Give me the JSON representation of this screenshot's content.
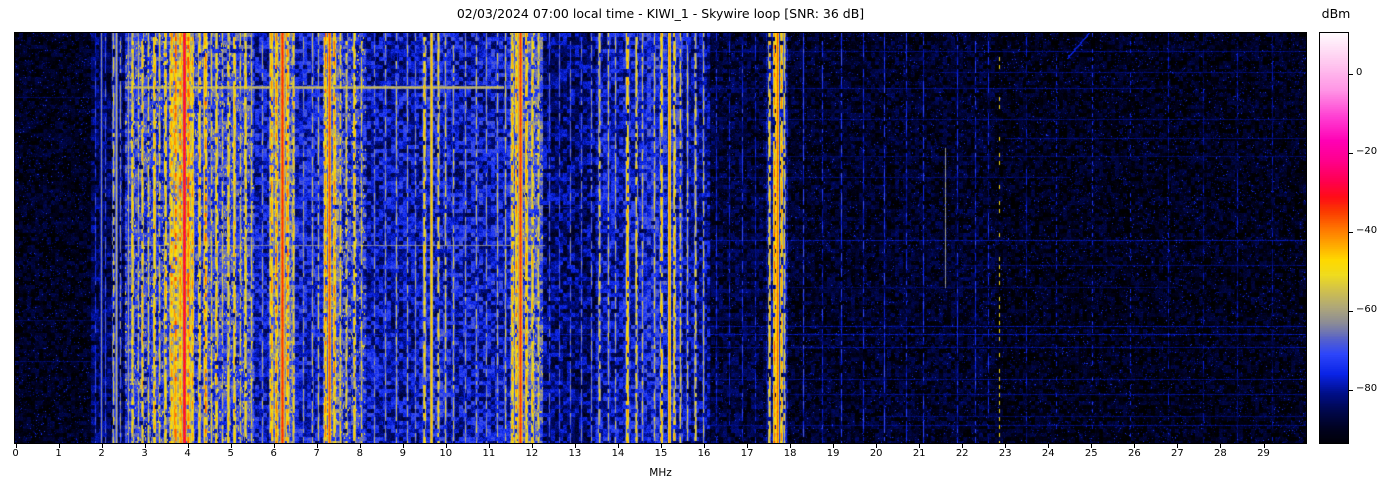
{
  "figure": {
    "title": "02/03/2024 07:00 local time - KIWI_1 - Skywire loop [SNR: 36 dB]",
    "background": "#ffffff"
  },
  "axes": {
    "xlabel": "MHz",
    "x_ticks": [
      "0",
      "1",
      "2",
      "3",
      "4",
      "5",
      "6",
      "7",
      "8",
      "9",
      "10",
      "11",
      "12",
      "13",
      "14",
      "15",
      "16",
      "17",
      "18",
      "19",
      "20",
      "21",
      "22",
      "23",
      "24",
      "25",
      "26",
      "27",
      "28",
      "29"
    ],
    "x_tick_values": [
      0,
      1,
      2,
      3,
      4,
      5,
      6,
      7,
      8,
      9,
      10,
      11,
      12,
      13,
      14,
      15,
      16,
      17,
      18,
      19,
      20,
      21,
      22,
      23,
      24,
      25,
      26,
      27,
      28,
      29
    ],
    "x_range": [
      0,
      30
    ],
    "y_ticks": []
  },
  "colorbar": {
    "title": "dBm",
    "tick_labels": [
      "0",
      "−20",
      "−40",
      "−60",
      "−80"
    ],
    "tick_values": [
      0,
      -20,
      -40,
      -60,
      -80
    ],
    "vmax": 10.4,
    "vmin": -93.4
  },
  "chart_data": {
    "type": "heatmap",
    "subtype": "spectrogram-waterfall",
    "title": "02/03/2024 07:00 local time - KIWI_1 - Skywire loop [SNR: 36 dB]",
    "xlabel": "MHz",
    "x_range": [
      0,
      30
    ],
    "y_axis_represents": "time (no tick labels shown)",
    "value_units": "dBm",
    "value_range": [
      -93.4,
      10.4
    ],
    "snr_db": 36,
    "receiver": "KIWI_1",
    "antenna": "Skywire loop",
    "datetime_local": "02/03/2024 07:00",
    "seed": 1337,
    "colormap_stops": [
      [
        -95,
        "#000000"
      ],
      [
        -90,
        "#01021f"
      ],
      [
        -86,
        "#000747"
      ],
      [
        -81,
        "#000e86"
      ],
      [
        -76,
        "#0a24e8"
      ],
      [
        -71,
        "#2e46fa"
      ],
      [
        -67,
        "#5a64c8"
      ],
      [
        -63,
        "#8c8c96"
      ],
      [
        -59,
        "#b0a878"
      ],
      [
        -55,
        "#cfc04e"
      ],
      [
        -51,
        "#f0dc1e"
      ],
      [
        -47,
        "#ffd900"
      ],
      [
        -43,
        "#ffa600"
      ],
      [
        -39,
        "#ff7300"
      ],
      [
        -35,
        "#fb3c00"
      ],
      [
        -31,
        "#ff0d17"
      ],
      [
        -27,
        "#ff0051"
      ],
      [
        -22,
        "#ff008c"
      ],
      [
        -17,
        "#ff00b4"
      ],
      [
        -11,
        "#ff3cd2"
      ],
      [
        -4,
        "#ff96e6"
      ],
      [
        3,
        "#ffc8f0"
      ],
      [
        11,
        "#ffffff"
      ]
    ],
    "bands": [
      [
        0.0,
        1.75,
        -91,
        0.2
      ],
      [
        1.75,
        2.55,
        -85,
        0.5
      ],
      [
        2.55,
        3.6,
        -74,
        1
      ],
      [
        3.6,
        4.15,
        -62,
        1
      ],
      [
        4.15,
        5.55,
        -73,
        1
      ],
      [
        5.55,
        5.9,
        -78,
        0.8
      ],
      [
        5.9,
        6.5,
        -68,
        1
      ],
      [
        6.5,
        7.15,
        -77,
        0.8
      ],
      [
        7.15,
        7.55,
        -68,
        1
      ],
      [
        7.55,
        8.15,
        -74,
        1
      ],
      [
        8.15,
        9.45,
        -79,
        0.8
      ],
      [
        9.45,
        10.05,
        -76,
        0.9
      ],
      [
        10.05,
        11.5,
        -78,
        0.9
      ],
      [
        11.5,
        12.25,
        -70,
        1
      ],
      [
        12.25,
        13.5,
        -83,
        0.7
      ],
      [
        13.5,
        14.1,
        -79,
        0.8
      ],
      [
        14.1,
        14.65,
        -78,
        0.8
      ],
      [
        14.65,
        15.5,
        -76,
        0.9
      ],
      [
        15.5,
        16.15,
        -81,
        0.7
      ],
      [
        16.15,
        17.45,
        -88,
        0.4
      ],
      [
        17.45,
        17.95,
        -82,
        0.6
      ],
      [
        17.95,
        22.8,
        -90,
        0.3
      ],
      [
        22.8,
        30.0,
        -91.5,
        0.25
      ]
    ],
    "stripes": [
      [
        2.0,
        1,
        -62,
        0
      ],
      [
        2.35,
        1.2,
        -57,
        0
      ],
      [
        2.62,
        1,
        -60,
        0
      ],
      [
        3.93,
        1.4,
        -26,
        0
      ],
      [
        6.21,
        1.6,
        -33,
        0
      ],
      [
        7.3,
        1.4,
        -36,
        0
      ],
      [
        9.66,
        1.2,
        -45,
        0
      ],
      [
        11.73,
        1.6,
        -34,
        0
      ],
      [
        15.19,
        1.3,
        -41,
        0
      ],
      [
        17.7,
        1.3,
        -37,
        0
      ],
      [
        1.85,
        1,
        -76,
        1
      ],
      [
        2.1,
        1,
        -72,
        1
      ],
      [
        2.28,
        1,
        -55,
        1
      ],
      [
        2.45,
        1,
        -65,
        1
      ],
      [
        2.72,
        1.5,
        -52,
        1
      ],
      [
        2.85,
        1,
        -58,
        1
      ],
      [
        2.95,
        1.2,
        -50,
        1
      ],
      [
        3.1,
        1,
        -55,
        1
      ],
      [
        3.22,
        1.5,
        -48,
        1
      ],
      [
        3.35,
        1,
        -53,
        1
      ],
      [
        3.48,
        1.5,
        -49,
        1
      ],
      [
        3.62,
        2,
        -46,
        1
      ],
      [
        3.72,
        2,
        -43,
        1
      ],
      [
        3.83,
        2,
        -44,
        1
      ],
      [
        4.02,
        2,
        -42,
        1
      ],
      [
        4.12,
        1.5,
        -46,
        1
      ],
      [
        4.28,
        1.5,
        -49,
        1
      ],
      [
        4.42,
        1.8,
        -44,
        1
      ],
      [
        4.55,
        1,
        -54,
        1
      ],
      [
        4.68,
        1.5,
        -50,
        1
      ],
      [
        4.82,
        1,
        -56,
        1
      ],
      [
        4.95,
        1.5,
        -51,
        1
      ],
      [
        5.08,
        1.5,
        -49,
        1
      ],
      [
        5.22,
        1,
        -57,
        1
      ],
      [
        5.35,
        1.5,
        -52,
        1
      ],
      [
        5.48,
        1,
        -56,
        1
      ],
      [
        5.75,
        1,
        -62,
        1
      ],
      [
        5.95,
        1.8,
        -47,
        1
      ],
      [
        6.07,
        1.5,
        -44,
        1
      ],
      [
        6.32,
        1.8,
        -45,
        1
      ],
      [
        6.45,
        1.2,
        -51,
        1
      ],
      [
        6.7,
        1,
        -64,
        1
      ],
      [
        6.9,
        1,
        -60,
        1
      ],
      [
        7.05,
        1,
        -58,
        1
      ],
      [
        7.21,
        1.5,
        -44,
        1
      ],
      [
        7.42,
        1.5,
        -45,
        1
      ],
      [
        7.55,
        1,
        -52,
        1
      ],
      [
        7.7,
        1.2,
        -54,
        1
      ],
      [
        7.88,
        1.5,
        -50,
        1
      ],
      [
        8.05,
        1,
        -56,
        1
      ],
      [
        8.35,
        1,
        -66,
        1
      ],
      [
        8.6,
        1,
        -63,
        1
      ],
      [
        8.85,
        1,
        -60,
        1
      ],
      [
        9.1,
        1,
        -62,
        1
      ],
      [
        9.3,
        1,
        -65,
        1
      ],
      [
        9.5,
        1.5,
        -51,
        1
      ],
      [
        9.82,
        1.2,
        -53,
        1
      ],
      [
        10.0,
        1,
        -57,
        1
      ],
      [
        10.18,
        1,
        -58,
        1
      ],
      [
        10.45,
        1,
        -62,
        1
      ],
      [
        10.72,
        1,
        -60,
        1
      ],
      [
        10.95,
        1,
        -64,
        1
      ],
      [
        11.2,
        1,
        -61,
        1
      ],
      [
        11.38,
        1,
        -58,
        1
      ],
      [
        11.55,
        1.5,
        -48,
        1
      ],
      [
        11.65,
        1.5,
        -45,
        1
      ],
      [
        11.88,
        1.5,
        -47,
        1
      ],
      [
        12.02,
        1.5,
        -50,
        1
      ],
      [
        12.15,
        1.2,
        -53,
        1
      ],
      [
        12.4,
        1,
        -70,
        1
      ],
      [
        12.65,
        1,
        -72,
        1
      ],
      [
        12.9,
        1,
        -69,
        1
      ],
      [
        13.15,
        1,
        -68,
        1
      ],
      [
        13.38,
        1,
        -66,
        1
      ],
      [
        13.58,
        1.2,
        -56,
        1
      ],
      [
        13.78,
        1,
        -59,
        1
      ],
      [
        13.95,
        1,
        -62,
        1
      ],
      [
        14.22,
        1.6,
        -48,
        1
      ],
      [
        14.42,
        1.2,
        -53,
        1
      ],
      [
        14.58,
        1,
        -58,
        1
      ],
      [
        14.85,
        1,
        -56,
        1
      ],
      [
        15.02,
        1.5,
        -49,
        1
      ],
      [
        15.32,
        1.4,
        -50,
        1
      ],
      [
        15.45,
        1,
        -55,
        1
      ],
      [
        15.62,
        1,
        -58,
        1
      ],
      [
        15.8,
        1.2,
        -56,
        1
      ],
      [
        15.98,
        1,
        -60,
        1
      ],
      [
        16.3,
        1,
        -78,
        1
      ],
      [
        16.6,
        1,
        -80,
        1
      ],
      [
        16.9,
        1,
        -77,
        1
      ],
      [
        17.2,
        1,
        -79,
        1
      ],
      [
        17.52,
        1.2,
        -51,
        1
      ],
      [
        17.63,
        1.3,
        -43,
        1
      ],
      [
        17.8,
        1.3,
        -46,
        1
      ],
      [
        17.88,
        1,
        -53,
        1
      ],
      [
        18.3,
        1,
        -75,
        1
      ],
      [
        18.75,
        1,
        -78,
        1
      ],
      [
        19.2,
        1,
        -76,
        1
      ],
      [
        19.7,
        1,
        -78,
        1
      ],
      [
        20.2,
        1,
        -77,
        1
      ],
      [
        20.7,
        1,
        -79,
        1
      ],
      [
        21.1,
        1,
        -78,
        1
      ],
      [
        21.9,
        1,
        -79,
        1
      ],
      [
        22.3,
        1,
        -77,
        1
      ],
      [
        22.6,
        1,
        -80,
        1
      ],
      [
        23.5,
        1,
        -83,
        1
      ],
      [
        26.8,
        1,
        -83,
        1
      ],
      [
        27.6,
        1,
        -84,
        1
      ],
      [
        28.4,
        1,
        -83,
        1
      ],
      [
        29.2,
        1,
        -84,
        1
      ]
    ],
    "vlines": [
      [
        21.62,
        0.28,
        0.62,
        -62,
        0
      ],
      [
        22.86,
        0.0,
        1.0,
        -50,
        1
      ],
      [
        24.2,
        0.03,
        0.97,
        -77,
        1
      ],
      [
        25.02,
        0.0,
        1.0,
        -75,
        1
      ],
      [
        25.92,
        0.0,
        1.0,
        -76,
        1
      ]
    ],
    "h_streaks": [
      [
        0.132,
        2.55,
        11.35,
        -57
      ],
      [
        0.518,
        2.55,
        12.3,
        -64
      ],
      [
        0.045,
        16.0,
        30,
        -82
      ],
      [
        0.095,
        21.5,
        30,
        -83
      ],
      [
        0.135,
        16.0,
        26.5,
        -82
      ],
      [
        0.155,
        0,
        1.78,
        -85
      ],
      [
        0.21,
        17.0,
        30,
        -83
      ],
      [
        0.255,
        23.0,
        30,
        -83
      ],
      [
        0.3,
        16.2,
        30,
        -84
      ],
      [
        0.35,
        16.0,
        24.5,
        -83
      ],
      [
        0.425,
        10.0,
        16.0,
        -80
      ],
      [
        0.505,
        16.0,
        30,
        -80
      ],
      [
        0.565,
        22.0,
        30,
        -83
      ],
      [
        0.62,
        17.5,
        27.0,
        -84
      ],
      [
        0.7,
        0,
        1.78,
        -85
      ],
      [
        0.715,
        16.0,
        30,
        -80
      ],
      [
        0.735,
        8.0,
        30,
        -79
      ],
      [
        0.765,
        16.0,
        30,
        -81
      ],
      [
        0.8,
        0,
        2.55,
        -84
      ],
      [
        0.845,
        16.0,
        30,
        -82
      ],
      [
        0.88,
        18.0,
        30,
        -82
      ],
      [
        0.935,
        20.0,
        30,
        -83
      ],
      [
        0.955,
        16.0,
        30,
        -82
      ]
    ],
    "diagonal": {
      "f0": 24.45,
      "yf0": 0.062,
      "f1": 24.95,
      "yf1": 0.0,
      "level": -77
    }
  }
}
